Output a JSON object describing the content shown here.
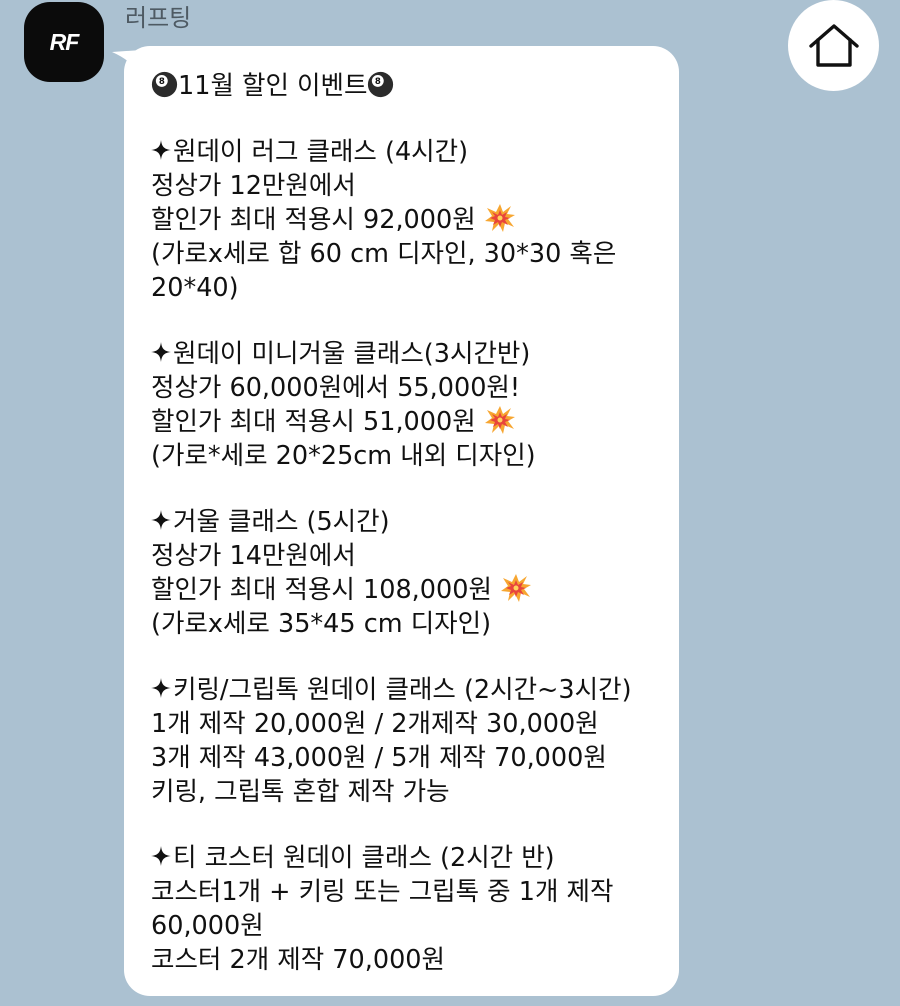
{
  "chat": {
    "sender_name": "러프팅",
    "avatar_text": "RF"
  },
  "header": {
    "home_button_icon": "home-icon"
  },
  "message": {
    "title": "11월 할인 이벤트",
    "sections": [
      {
        "heading": "원데이 러그 클래스 (4시간)",
        "lines": [
          "정상가 12만원에서",
          "할인가 최대 적용시 92,000원",
          "(가로x세로 합 60 cm 디자인, 30*30 혹은",
          "20*40)"
        ]
      },
      {
        "heading": "원데이 미니거울 클래스(3시간반)",
        "lines": [
          "정상가 60,000원에서 55,000원!",
          "할인가 최대 적용시 51,000원",
          "(가로*세로 20*25cm 내외 디자인)"
        ]
      },
      {
        "heading": "거울 클래스 (5시간)",
        "lines": [
          "정상가 14만원에서",
          "할인가 최대 적용시 108,000원",
          "(가로x세로 35*45 cm 디자인)"
        ]
      },
      {
        "heading": "키링/그립톡 원데이 클래스 (2시간~3시간)",
        "lines": [
          "1개 제작 20,000원 / 2개제작 30,000원",
          "3개 제작 43,000원 / 5개 제작 70,000원",
          "키링, 그립톡 혼합 제작 가능"
        ]
      },
      {
        "heading": "티 코스터 원데이 클래스 (2시간 반)",
        "lines": [
          "코스터1개 + 키링 또는 그립톡 중 1개 제작",
          "60,000원",
          "코스터 2개 제작 70,000원"
        ]
      }
    ]
  },
  "icons": {
    "title_emoji": "eight-ball-icon",
    "price_emoji": "collision-icon",
    "bullet": "four-pointed-star-icon"
  },
  "colors": {
    "background": "#abc1d1",
    "bubble": "#ffffff",
    "avatar": "#0b0b0b",
    "text": "#111111",
    "sender_text": "#4e5a63"
  }
}
